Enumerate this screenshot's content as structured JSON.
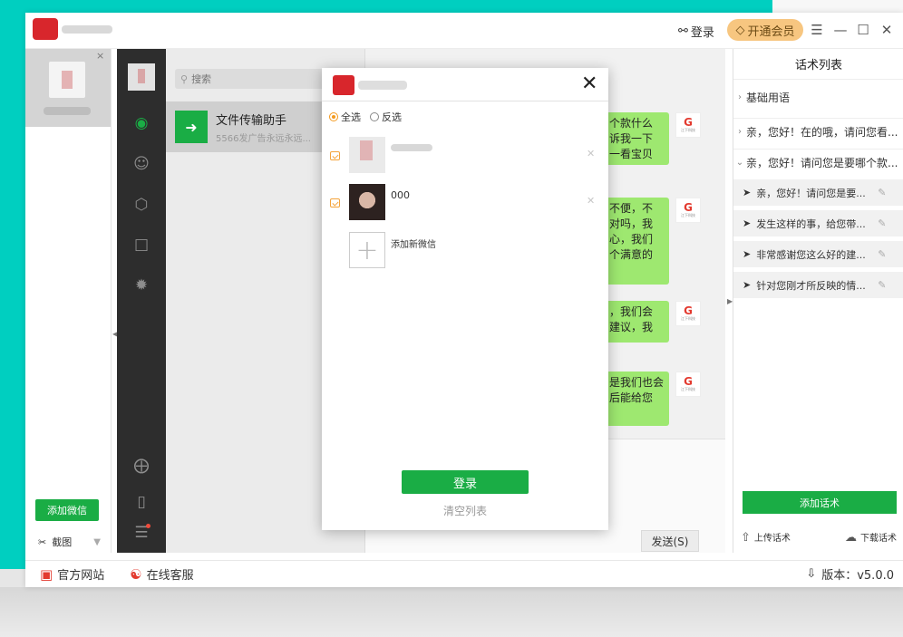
{
  "titlebar": {
    "login_label": "登录",
    "vip_label": "开通会员",
    "menu_glyph": "☰",
    "min_glyph": "—",
    "max_glyph": "☐",
    "close_glyph": "✕"
  },
  "accounts": {
    "close_glyph": "×",
    "add_button": "添加微信",
    "screenshot_label": "截图"
  },
  "conversations": {
    "search_placeholder": "搜索",
    "items": [
      {
        "title": "文件传输助手",
        "subtitle": "5566发广告永远永远...",
        "icon": "folder-icon"
      }
    ]
  },
  "chat": {
    "bubbles": [
      "个款什么\n诉我一下\n一看宝贝",
      "不便，不\n对吗，我\n心，我们\n个满意的",
      "，我们会\n建议，我",
      "是我们也会\n后能给您"
    ],
    "logo_mark": "G",
    "logo_text": "江下科技",
    "send_button": "发送(S)"
  },
  "phrases": {
    "title": "话术列表",
    "groups": [
      {
        "label": "基础用语",
        "caret": "›"
      },
      {
        "label": "亲，您好！在的哦，请问您看...",
        "caret": "›"
      },
      {
        "label": "亲，您好！请问您是要哪个款...",
        "caret": "⌄"
      }
    ],
    "items": [
      "亲，您好！请问您是要...",
      "发生这样的事，给您带...",
      "非常感谢您这么好的建...",
      "针对您刚才所反映的情..."
    ],
    "add_button": "添加话术",
    "upload_label": "上传话术",
    "download_label": "下载话术"
  },
  "statusbar": {
    "website_label": "官方网站",
    "service_label": "在线客服",
    "version_label": "版本：v5.0.0"
  },
  "modal": {
    "close_glyph": "✕",
    "select_all": "全选",
    "invert_select": "反选",
    "accounts": [
      {
        "label": ""
      },
      {
        "label": "000"
      }
    ],
    "add_new_label": "添加新微信",
    "login_button": "登录",
    "clear_list": "清空列表"
  }
}
